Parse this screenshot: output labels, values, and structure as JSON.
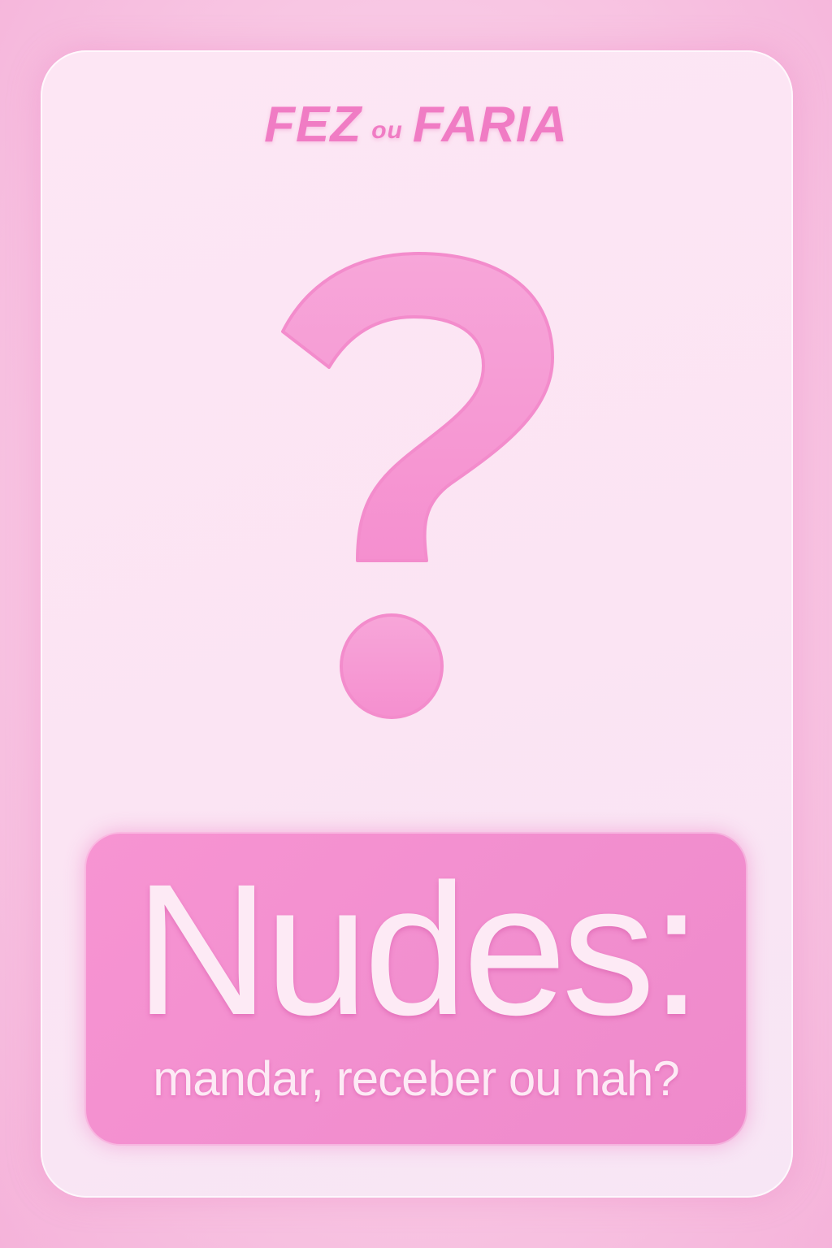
{
  "brand": {
    "word1": "FEZ",
    "connector": "ou",
    "word2": "FARIA"
  },
  "icon": "question-mark-icon",
  "card": {
    "headline": "Nudes:",
    "subline": "mandar, receber ou nah?"
  },
  "colors": {
    "accent": "#f07cc4",
    "panel": "#f28fcf",
    "card": "#fde6f4",
    "text_light": "#fdeaf5"
  }
}
